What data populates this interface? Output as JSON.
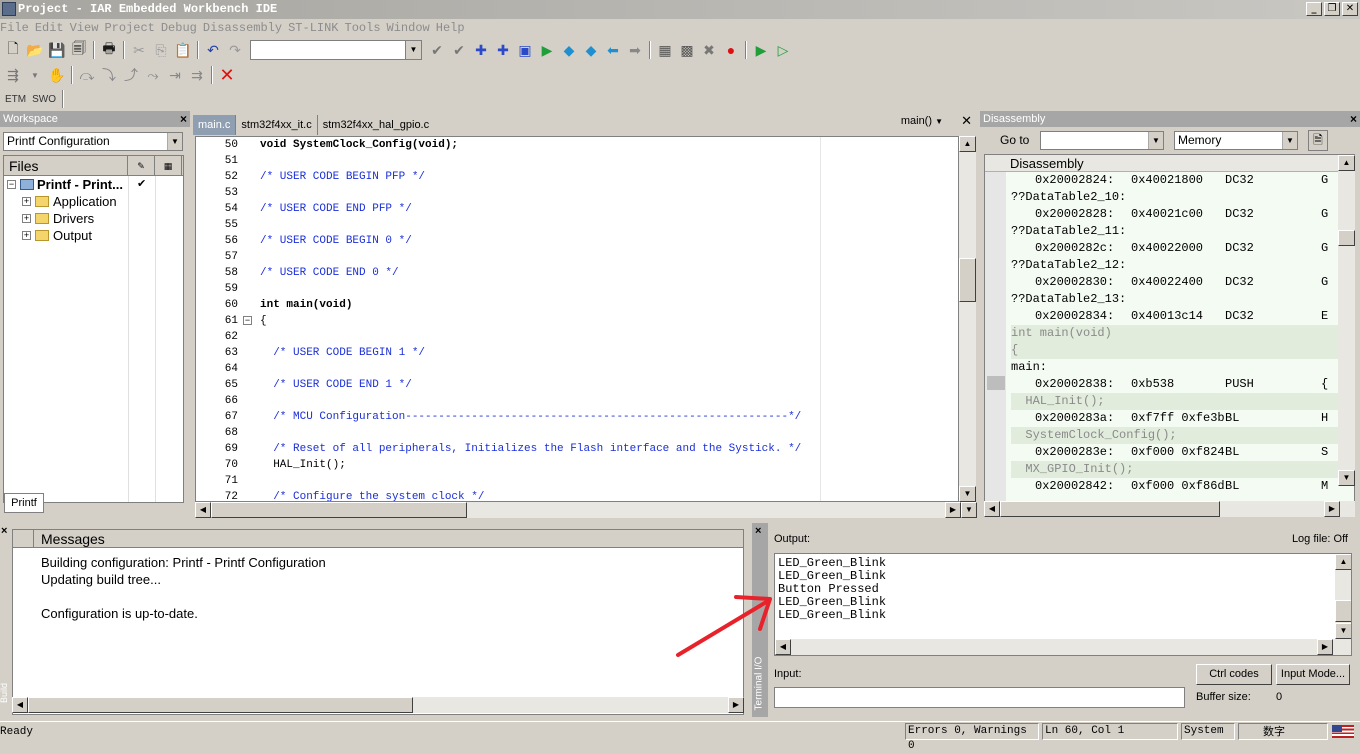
{
  "window": {
    "title": "Project - IAR Embedded Workbench IDE"
  },
  "menu": [
    "File",
    "Edit",
    "View",
    "Project",
    "Debug",
    "Disassembly",
    "ST-LINK",
    "Tools",
    "Window",
    "Help"
  ],
  "toolbar3": {
    "etm": "ETM",
    "swo": "SWO"
  },
  "workspace": {
    "title": "Workspace",
    "config": "Printf Configuration",
    "files_header": "Files",
    "project": "Printf - Print...",
    "items": [
      "Application",
      "Drivers",
      "Output"
    ],
    "tab": "Printf"
  },
  "editor": {
    "tabs": [
      "main.c",
      "stm32f4xx_it.c",
      "stm32f4xx_hal_gpio.c"
    ],
    "function": "main()",
    "lines": [
      {
        "n": "50",
        "t": "void SystemClock_Config(void);"
      },
      {
        "n": "51",
        "t": ""
      },
      {
        "n": "52",
        "t": "/* USER CODE BEGIN PFP */"
      },
      {
        "n": "53",
        "t": ""
      },
      {
        "n": "54",
        "t": "/* USER CODE END PFP */"
      },
      {
        "n": "55",
        "t": ""
      },
      {
        "n": "56",
        "t": "/* USER CODE BEGIN 0 */"
      },
      {
        "n": "57",
        "t": ""
      },
      {
        "n": "58",
        "t": "/* USER CODE END 0 */"
      },
      {
        "n": "59",
        "t": ""
      },
      {
        "n": "60",
        "t": "int main(void)"
      },
      {
        "n": "61",
        "t": "{"
      },
      {
        "n": "62",
        "t": ""
      },
      {
        "n": "63",
        "t": "  /* USER CODE BEGIN 1 */"
      },
      {
        "n": "64",
        "t": ""
      },
      {
        "n": "65",
        "t": "  /* USER CODE END 1 */"
      },
      {
        "n": "66",
        "t": ""
      },
      {
        "n": "67",
        "t": "  /* MCU Configuration----------------------------------------------------------*/"
      },
      {
        "n": "68",
        "t": ""
      },
      {
        "n": "69",
        "t": "  /* Reset of all peripherals, Initializes the Flash interface and the Systick. */"
      },
      {
        "n": "70",
        "t": "  HAL_Init();"
      },
      {
        "n": "71",
        "t": ""
      },
      {
        "n": "72",
        "t": "  /* Configure the system clock */"
      }
    ]
  },
  "disassembly": {
    "title": "Disassembly",
    "goto_label": "Go to",
    "memory": "Memory",
    "header": "Disassembly",
    "lines": [
      {
        "kind": "ins",
        "addr": "0x20002824:",
        "code": "0x40021800",
        "mn": "DC32",
        "op": "G"
      },
      {
        "kind": "lbl",
        "text": "??DataTable2_10:"
      },
      {
        "kind": "ins",
        "addr": "0x20002828:",
        "code": "0x40021c00",
        "mn": "DC32",
        "op": "G"
      },
      {
        "kind": "lbl",
        "text": "??DataTable2_11:"
      },
      {
        "kind": "ins",
        "addr": "0x2000282c:",
        "code": "0x40022000",
        "mn": "DC32",
        "op": "G"
      },
      {
        "kind": "lbl",
        "text": "??DataTable2_12:"
      },
      {
        "kind": "ins",
        "addr": "0x20002830:",
        "code": "0x40022400",
        "mn": "DC32",
        "op": "G"
      },
      {
        "kind": "lbl",
        "text": "??DataTable2_13:"
      },
      {
        "kind": "ins",
        "addr": "0x20002834:",
        "code": "0x40013c14",
        "mn": "DC32",
        "op": "E"
      },
      {
        "kind": "src",
        "text": "int main(void)"
      },
      {
        "kind": "src",
        "text": "{"
      },
      {
        "kind": "lbl",
        "text": "main:"
      },
      {
        "kind": "ins",
        "addr": "0x20002838:",
        "code": "0xb538",
        "mn": "PUSH",
        "op": "{"
      },
      {
        "kind": "src",
        "text": "  HAL_Init();"
      },
      {
        "kind": "ins",
        "addr": "0x2000283a:",
        "code": "0xf7ff 0xfe3b",
        "mn": "BL",
        "op": "H"
      },
      {
        "kind": "src",
        "text": "  SystemClock_Config();"
      },
      {
        "kind": "ins",
        "addr": "0x2000283e:",
        "code": "0xf000 0xf824",
        "mn": "BL",
        "op": "S"
      },
      {
        "kind": "src",
        "text": "  MX_GPIO_Init();"
      },
      {
        "kind": "ins",
        "addr": "0x20002842:",
        "code": "0xf000 0xf86d",
        "mn": "BL",
        "op": "M"
      }
    ]
  },
  "build": {
    "side_label": "Build",
    "header": "Messages",
    "messages": [
      "Building configuration: Printf - Printf Configuration",
      "Updating build tree...",
      "",
      "Configuration is up-to-date."
    ]
  },
  "terminal": {
    "side_label": "Terminal I/O",
    "output_label": "Output:",
    "logfile": "Log file: Off",
    "output": [
      "LED_Green_Blink",
      "LED_Green_Blink",
      "Button Pressed",
      "LED_Green_Blink",
      "LED_Green_Blink"
    ],
    "input_label": "Input:",
    "ctrl_codes": "Ctrl codes",
    "input_mode": "Input Mode...",
    "buffer_label": "Buffer size:",
    "buffer_value": "0"
  },
  "status": {
    "ready": "Ready",
    "errors": "Errors 0, Warnings 0",
    "position": "Ln 60, Col 1",
    "mode": "System",
    "ime": "数字"
  }
}
